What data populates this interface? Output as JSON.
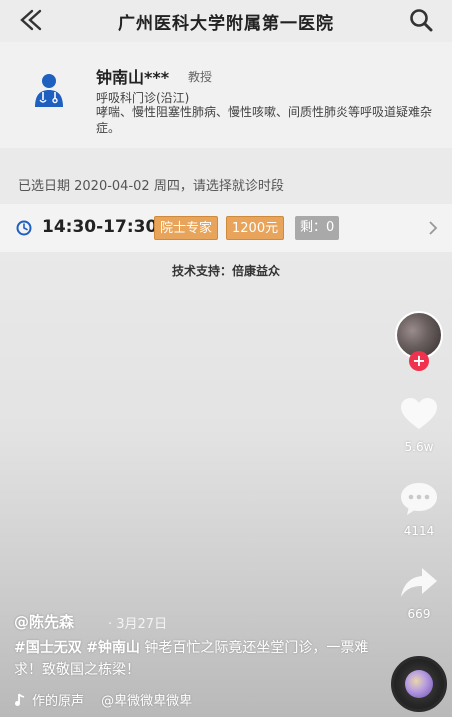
{
  "header": {
    "title": "广州医科大学附属第一医院"
  },
  "doctor": {
    "name": "钟南山***",
    "title": "教授",
    "department": "呼吸科门诊(沿江)",
    "expertise": "哮喘、慢性阻塞性肺病、慢性咳嗽、间质性肺炎等呼吸道疑难杂症。"
  },
  "schedule": {
    "selected_date_text": "已选日期 2020-04-02 周四，请选择就诊时段",
    "slot": {
      "time": "14:30-17:30",
      "type_badge": "院士专家",
      "price_badge": "1200元",
      "remaining_badge": "剩：0"
    },
    "tech_support": "技术支持：倍康益众"
  },
  "side_actions": {
    "like_count": "5.6w",
    "comment_count": "4114",
    "share_count": "669",
    "follow_symbol": "+"
  },
  "post": {
    "author": "@陈先森",
    "date": "· 3月27日",
    "hashtag1": "#国士无双",
    "hashtag2": "#钟南山",
    "caption_text": " 钟老百忙之际竟还坐堂门诊，一票难求！致敬国之栋梁！",
    "music": "作的原声　 @卑微微卑微卑"
  },
  "colors": {
    "badge_orange": "#e8a45a",
    "badge_gray": "#a9a9a9",
    "follow_red": "#f0324e",
    "avatar_blue": "#1f5fbf"
  },
  "icons": [
    "back-icon",
    "search-icon",
    "doctor-avatar-icon",
    "clock-icon",
    "chevron-right-icon",
    "heart-icon",
    "comment-icon",
    "share-icon",
    "music-note-icon"
  ]
}
